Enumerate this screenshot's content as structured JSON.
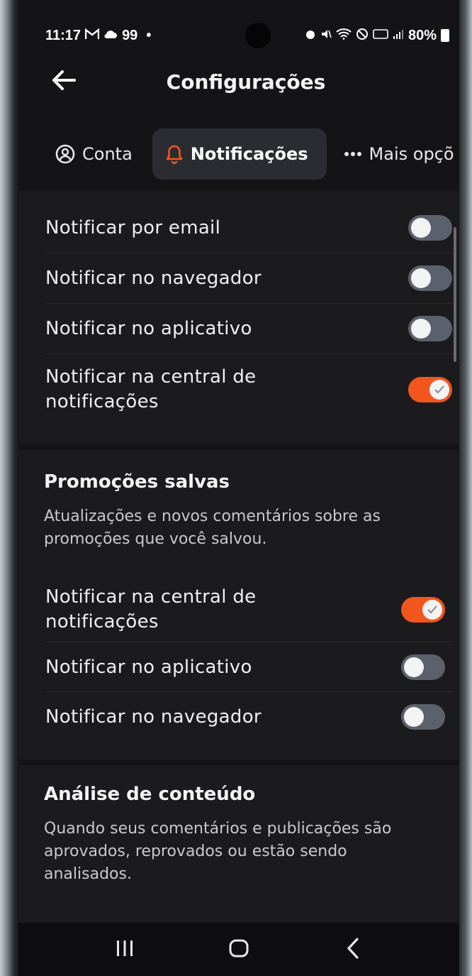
{
  "status_bar": {
    "time": "11:17",
    "left_icons": [
      "gmail-icon",
      "cloud-icon"
    ],
    "badge_count": "99",
    "dot": "•",
    "battery": "80%"
  },
  "header": {
    "title": "Configurações"
  },
  "tabs": [
    {
      "label": "Conta",
      "icon": "user-circle-icon",
      "active": false
    },
    {
      "label": "Notificações",
      "icon": "bell-icon",
      "active": true
    },
    {
      "label": "Mais opçõ",
      "icon": "more-dots-icon",
      "active": false
    }
  ],
  "general": {
    "rows": [
      {
        "label": "Notificar por email",
        "on": false
      },
      {
        "label": "Notificar no navegador",
        "on": false
      },
      {
        "label": "Notificar no aplicativo",
        "on": false
      },
      {
        "label_line1": "Notificar na central de",
        "label_line2": "notificações",
        "on": true
      }
    ]
  },
  "saved_promotions": {
    "title": "Promoções salvas",
    "description": "Atualizações e novos comentários sobre as promoções que você salvou.",
    "rows": [
      {
        "label_line1": "Notificar na central de",
        "label_line2": "notificações",
        "on": true
      },
      {
        "label": "Notificar no aplicativo",
        "on": false
      },
      {
        "label": "Notificar no navegador",
        "on": false
      }
    ]
  },
  "content_analysis": {
    "title": "Análise de conteúdo",
    "description": "Quando seus comentários e publicações são aprovados, reprovados ou estão sendo analisados."
  },
  "colors": {
    "accent": "#f2561d",
    "toggle_off": "#5b616c",
    "background": "#141416",
    "section": "#1b1b1e"
  },
  "nav_bar": [
    "recent-apps-icon",
    "home-icon",
    "back-icon"
  ]
}
